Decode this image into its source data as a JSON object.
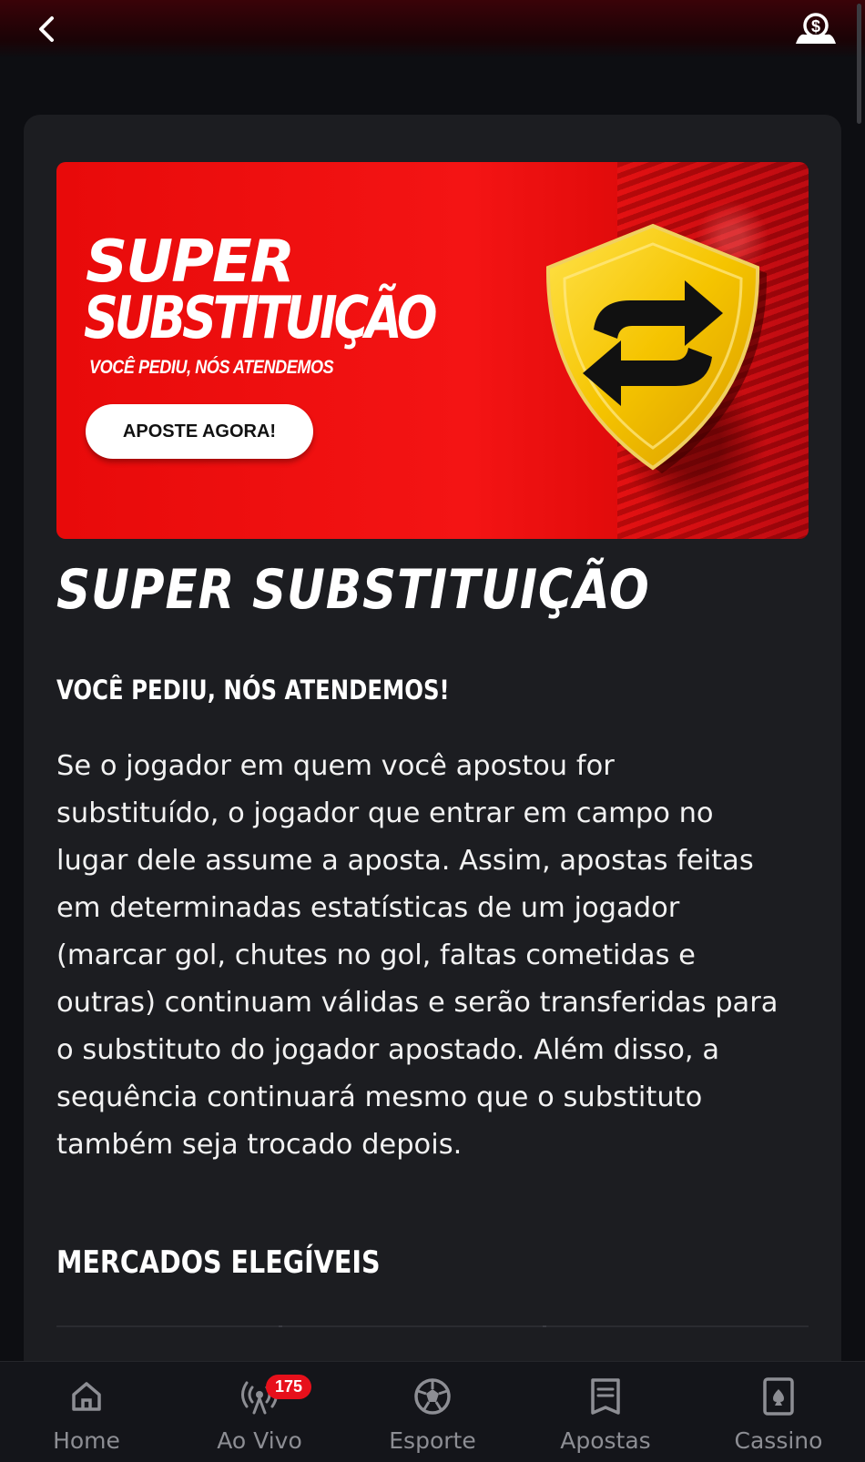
{
  "header": {
    "back_icon": "chevron-left-icon",
    "wallet_icon": "dollar-hand-icon"
  },
  "banner": {
    "title_line1": "SUPER",
    "title_line2": "SUBSTITUIÇÃO",
    "tagline": "VOCÊ PEDIU, NÓS ATENDEMOS",
    "cta_label": "APOSTE AGORA!",
    "colors": {
      "background": "#f01414",
      "shield": "#f5c400"
    }
  },
  "content": {
    "title": "SUPER SUBSTITUIÇÃO",
    "subtitle": "VOCÊ PEDIU, NÓS ATENDEMOS!",
    "paragraph": "Se o jogador em quem você apostou for substituído, o jogador que entrar em campo no lugar dele assume a aposta. Assim, apostas feitas em determinadas estatísticas de um jogador (marcar gol, chutes no gol, faltas cometidas e outras) continuam válidas e serão transferidas para o substituto do jogador apostado. Além disso, a sequência continuará mesmo que o substituto também seja trocado depois.",
    "markets_heading": "MERCADOS ELEGÍVEIS"
  },
  "bottom_nav": {
    "items": [
      {
        "label": "Home",
        "icon": "home-icon"
      },
      {
        "label": "Ao Vivo",
        "icon": "live-broadcast-icon",
        "badge": "175"
      },
      {
        "label": "Esporte",
        "icon": "soccer-ball-icon"
      },
      {
        "label": "Apostas",
        "icon": "bet-slip-icon"
      },
      {
        "label": "Cassino",
        "icon": "playing-card-icon"
      }
    ],
    "badge_color": "#e7101b"
  }
}
